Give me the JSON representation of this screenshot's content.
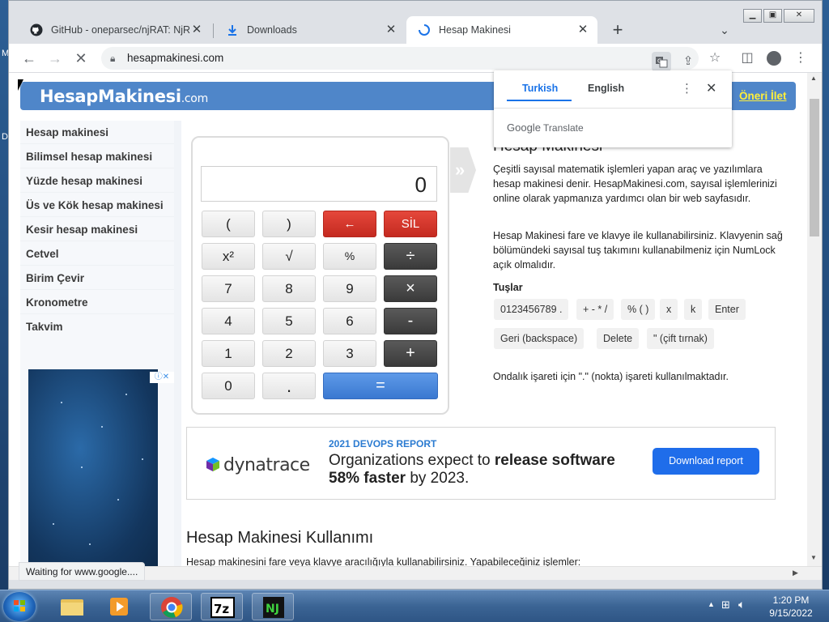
{
  "browser": {
    "tabs": [
      {
        "label": "GitHub - oneparsec/njRAT: NjRAT",
        "icon": "github-icon"
      },
      {
        "label": "Downloads",
        "icon": "download-icon"
      },
      {
        "label": "Hesap Makinesi",
        "icon": "loading-icon"
      }
    ],
    "url": "hesapmakinesi.com"
  },
  "translate_popup": {
    "source_lang": "Turkish",
    "target_lang": "English",
    "google": "Google",
    "translate": "Translate"
  },
  "site": {
    "logo_main": "HesapMakinesi",
    "logo_suffix": ".com",
    "suggest_link": "Öneri İlet",
    "sidebar": [
      "Hesap makinesi",
      "Bilimsel hesap makinesi",
      "Yüzde hesap makinesi",
      "Üs ve Kök hesap makinesi",
      "Kesir hesap makinesi",
      "Cetvel",
      "Birim Çevir",
      "Kronometre",
      "Takvim"
    ],
    "calculator": {
      "display": "0",
      "keys": [
        "(",
        ")",
        "←",
        "SİL",
        "x²",
        "√",
        "%",
        "÷",
        "7",
        "8",
        "9",
        "×",
        "4",
        "5",
        "6",
        "-",
        "1",
        "2",
        "3",
        "+",
        "0",
        ".",
        "="
      ]
    },
    "title_partial": "Hesap Makinesi",
    "para1": "Çeşitli sayısal matematik işlemleri yapan araç ve yazılımlara hesap makinesi denir. HesapMakinesi.com, sayısal işlemlerinizi online olarak yapmanıza yardımcı olan bir web sayfasıdır.",
    "para2": "Hesap Makinesi fare ve klavye ile kullanabilirsiniz. Klavyenin sağ bölümündeki sayısal tuş takımını kullanabilmeniz için NumLock açık olmalıdır.",
    "keys_heading": "Tuşlar",
    "key_chips": [
      "0123456789 .",
      "+ - * /",
      "% ( )",
      "x",
      "k",
      "Enter",
      "Geri (backspace)",
      "Delete",
      "\" (çift tırnak)"
    ],
    "decimal_note": "Ondalık işareti için \".\" (nokta) işareti kullanılmaktadır.",
    "ad": {
      "brand": "dynatrace",
      "kicker": "2021 DEVOPS REPORT",
      "line1a": "Organizations expect to ",
      "line1b": "release software",
      "line2a": "58% faster",
      "line2b": " by 2023.",
      "button": "Download report"
    },
    "usage_heading": "Hesap Makinesi Kullanımı",
    "usage_text": "Hesap makinesini fare veya klavye aracılığıyla kullanabilirsiniz. Yapabileceğiniz işlemler:"
  },
  "status_bar": "Waiting for www.google....",
  "taskbar": {
    "time": "1:20 PM",
    "date": "9/15/2022"
  }
}
